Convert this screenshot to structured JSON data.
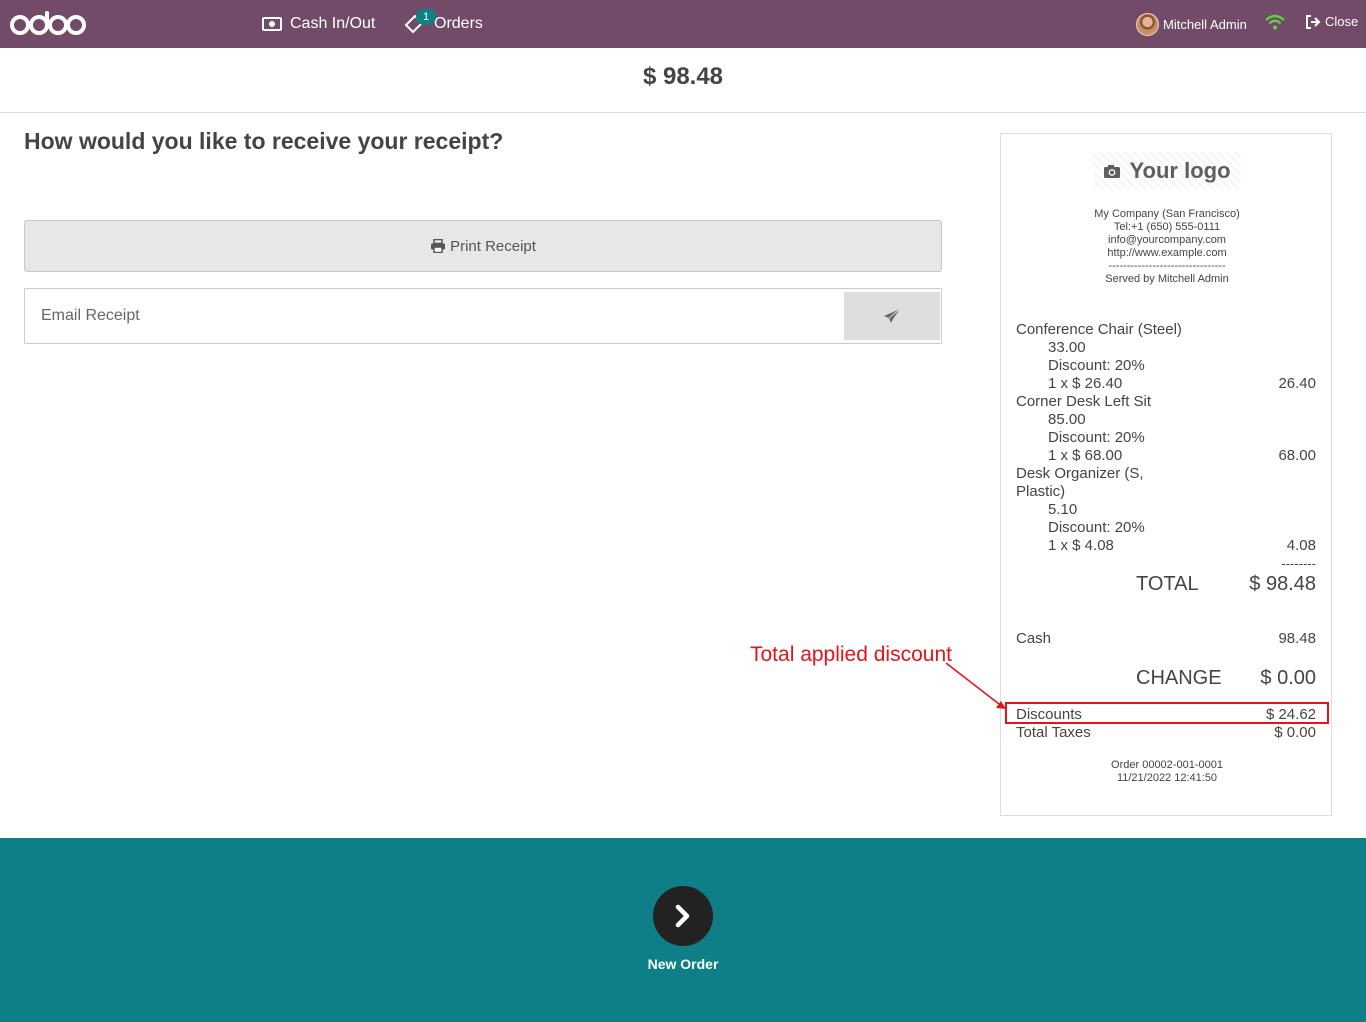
{
  "app": {
    "logo_text": "odoo"
  },
  "topbar": {
    "cash_label": "Cash In/Out",
    "orders_label": "Orders",
    "orders_badge": "1",
    "user_name": "Mitchell Admin",
    "close_label": "Close",
    "color": "#714b67"
  },
  "amount": "$ 98.48",
  "question": "How would you like to receive your receipt?",
  "print_label": "Print Receipt",
  "email": {
    "placeholder": "Email Receipt",
    "value": ""
  },
  "receipt": {
    "logo_text": "Your logo",
    "company_lines": [
      "My Company (San Francisco)",
      "Tel:+1 (650) 555-0111",
      "info@yourcompany.com",
      "http://www.example.com",
      "--------------------------------",
      "Served by Mitchell Admin"
    ],
    "lines": [
      {
        "name": "Conference Chair (Steel)",
        "price": "33.00",
        "discount": "Discount: 20%",
        "qty": "1 x $ 26.40",
        "total": "26.40"
      },
      {
        "name": "Corner Desk Left Sit",
        "price": "85.00",
        "discount": "Discount: 20%",
        "qty": "1 x $ 68.00",
        "total": "68.00"
      },
      {
        "name_line1": "Desk Organizer (S,",
        "name_line2": "Plastic)",
        "price": "5.10",
        "discount": "Discount: 20%",
        "qty": "1 x $ 4.08",
        "total": "4.08"
      }
    ],
    "separator": "--------",
    "total_label": "TOTAL",
    "total_value": "$ 98.48",
    "payment_label": "Cash",
    "payment_value": "98.48",
    "change_label": "CHANGE",
    "change_value": "$ 0.00",
    "discounts_label": "Discounts",
    "discounts_value": "$ 24.62",
    "taxes_label": "Total Taxes",
    "taxes_value": "$ 0.00",
    "order_ref": "Order 00002-001-0001",
    "order_date": "11/21/2022 12:41:50"
  },
  "annotation": {
    "text": "Total applied discount",
    "color": "#e3141b"
  },
  "bottom": {
    "next_label": "New Order",
    "color": "#0e7f86"
  }
}
